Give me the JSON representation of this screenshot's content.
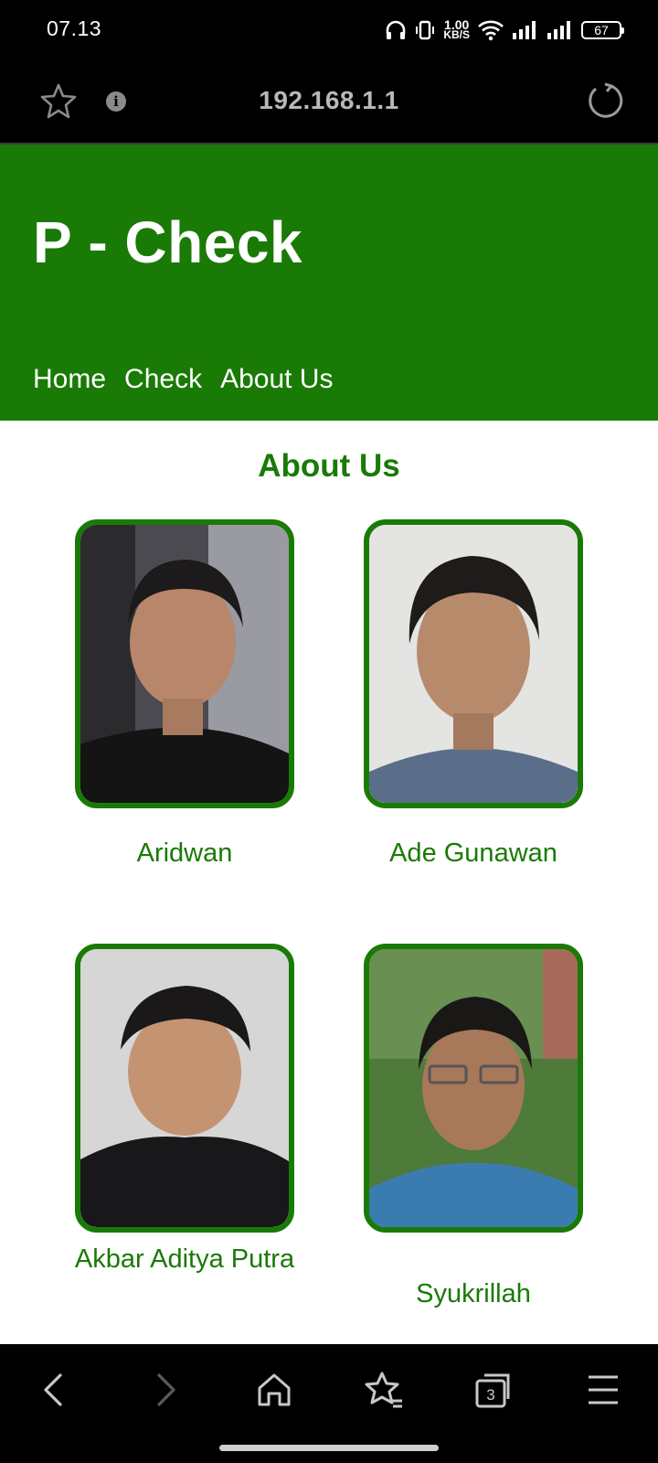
{
  "status_bar": {
    "time": "07.13",
    "net_speed_value": "1.00",
    "net_speed_unit": "KB/S",
    "battery": "67",
    "icons": [
      "headphones-icon",
      "vibrate-icon",
      "wifi-icon",
      "signal-icon",
      "signal-icon",
      "battery-icon"
    ]
  },
  "browser": {
    "url": "192.168.1.1",
    "info_glyph": "i",
    "icons": [
      "star-icon",
      "info-icon",
      "reload-icon"
    ]
  },
  "site": {
    "title": "P - Check",
    "nav": [
      "Home",
      "Check",
      "About Us"
    ],
    "heading": "About Us",
    "accent_color": "#1a7a06",
    "members": [
      {
        "name": "Aridwan"
      },
      {
        "name": "Ade Gunawan"
      },
      {
        "name": "Akbar Aditya Putra"
      },
      {
        "name": "Syukrillah"
      }
    ]
  },
  "nav_bar": {
    "tab_count": "3",
    "icons": [
      "back-icon",
      "forward-icon",
      "home-icon",
      "bookmarks-icon",
      "tabs-icon",
      "menu-icon"
    ]
  }
}
